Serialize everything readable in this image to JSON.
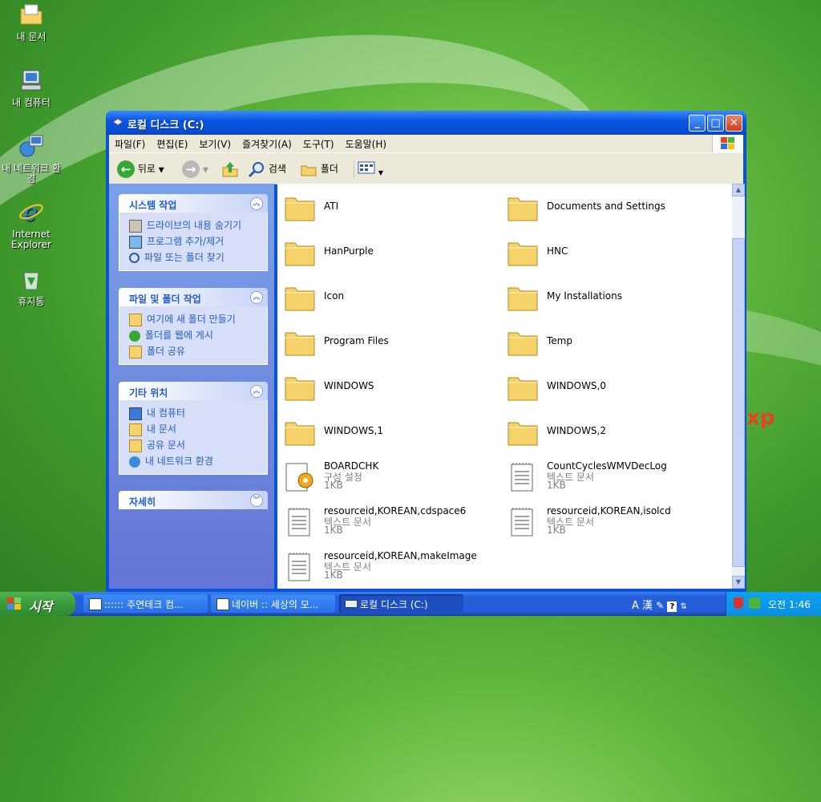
{
  "desktop": {
    "icons": [
      {
        "label": "내 문서",
        "icon": "my-documents-icon"
      },
      {
        "label": "내 컴퓨터",
        "icon": "my-computer-icon"
      },
      {
        "label": "내 네트워크 환경",
        "icon": "network-places-icon"
      },
      {
        "label": "Internet Explorer",
        "icon": "internet-explorer-icon"
      },
      {
        "label": "휴지통",
        "icon": "recycle-bin-icon"
      }
    ],
    "partial_text": "xp"
  },
  "window": {
    "title": "로컬 디스크 (C:)",
    "menu": [
      "파일(F)",
      "편집(E)",
      "보기(V)",
      "즐겨찾기(A)",
      "도구(T)",
      "도움말(H)"
    ],
    "toolbar": {
      "back": "뒤로",
      "search": "검색",
      "folders": "폴더"
    },
    "tasks": [
      {
        "title": "시스템 작업",
        "items": [
          "드라이브의 내용 숨기기",
          "프로그램 추가/제거",
          "파일 또는 폴더 찾기"
        ]
      },
      {
        "title": "파일 및 폴더 작업",
        "items": [
          "여기에 새 폴더 만들기",
          "폴더를 웹에 게시",
          "폴더 공유"
        ]
      },
      {
        "title": "기타 위치",
        "items": [
          "내 컴퓨터",
          "내 문서",
          "공유 문서",
          "내 네트워크 환경"
        ]
      },
      {
        "title": "자세히",
        "items": []
      }
    ],
    "files": [
      {
        "name": "ATI",
        "type": "folder"
      },
      {
        "name": "Documents and Settings",
        "type": "folder"
      },
      {
        "name": "HanPurple",
        "type": "folder"
      },
      {
        "name": "HNC",
        "type": "folder"
      },
      {
        "name": "Icon",
        "type": "folder"
      },
      {
        "name": "My Installations",
        "type": "folder"
      },
      {
        "name": "Program Files",
        "type": "folder"
      },
      {
        "name": "Temp",
        "type": "folder"
      },
      {
        "name": "WINDOWS",
        "type": "folder"
      },
      {
        "name": "WINDOWS,0",
        "type": "folder"
      },
      {
        "name": "WINDOWS,1",
        "type": "folder"
      },
      {
        "name": "WINDOWS,2",
        "type": "folder"
      },
      {
        "name": "BOARDCHK",
        "type": "config",
        "kind": "구성 설정",
        "size": "1KB"
      },
      {
        "name": "CountCyclesWMVDecLog",
        "type": "text",
        "kind": "텍스트 문서",
        "size": "1KB"
      },
      {
        "name": "resourceid,KOREAN,cdspace6",
        "type": "text",
        "kind": "텍스트 문서",
        "size": "1KB"
      },
      {
        "name": "resourceid,KOREAN,isolcd",
        "type": "text",
        "kind": "텍스트 문서",
        "size": "1KB"
      },
      {
        "name": "resourceid,KOREAN,makeImage",
        "type": "text",
        "kind": "텍스트 문서",
        "size": "1KB"
      }
    ]
  },
  "taskbar": {
    "start": "시작",
    "tasks": [
      ":::::: 주연테크 컴...",
      "네이버 :: 세상의 모...",
      "로컬 디스크 (C:)"
    ],
    "lang": "A 漢",
    "clock": "오전 1:46"
  },
  "colors": {
    "title_blue": "#0a55e3",
    "task_pane": "#6375d6",
    "link_blue": "#215dc6",
    "start_green": "#3c9b3c"
  }
}
